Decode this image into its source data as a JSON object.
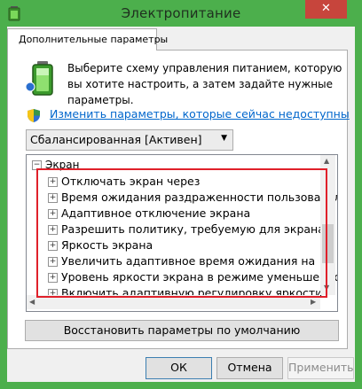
{
  "window": {
    "title": "Электропитание",
    "close_glyph": "✕"
  },
  "tab": {
    "label": "Дополнительные параметры"
  },
  "intro": {
    "text": "Выберите схему управления питанием, которую вы хотите настроить, а затем задайте нужные параметры."
  },
  "link": {
    "text": "Изменить параметры, которые сейчас недоступны"
  },
  "plan_select": {
    "value": "Сбалансированная [Активен]"
  },
  "tree": {
    "root": "Экран",
    "items": [
      "Отключать экран через",
      "Время ожидания раздраженности пользователя",
      "Адаптивное отключение экрана",
      "Разрешить политику, требуемую для экрана",
      "Яркость экрана",
      "Увеличить адаптивное время ожидания на",
      "Уровень яркости экрана в режиме уменьшенной яр",
      "Включить адаптивную регулировку яркости"
    ]
  },
  "buttons": {
    "restore": "Восстановить параметры по умолчанию",
    "ok": "ОК",
    "cancel": "Отмена",
    "apply": "Применить"
  },
  "colors": {
    "window_frame": "#4caf4c",
    "close": "#c7453c",
    "highlight": "#e0202a",
    "link": "#0066cc"
  }
}
